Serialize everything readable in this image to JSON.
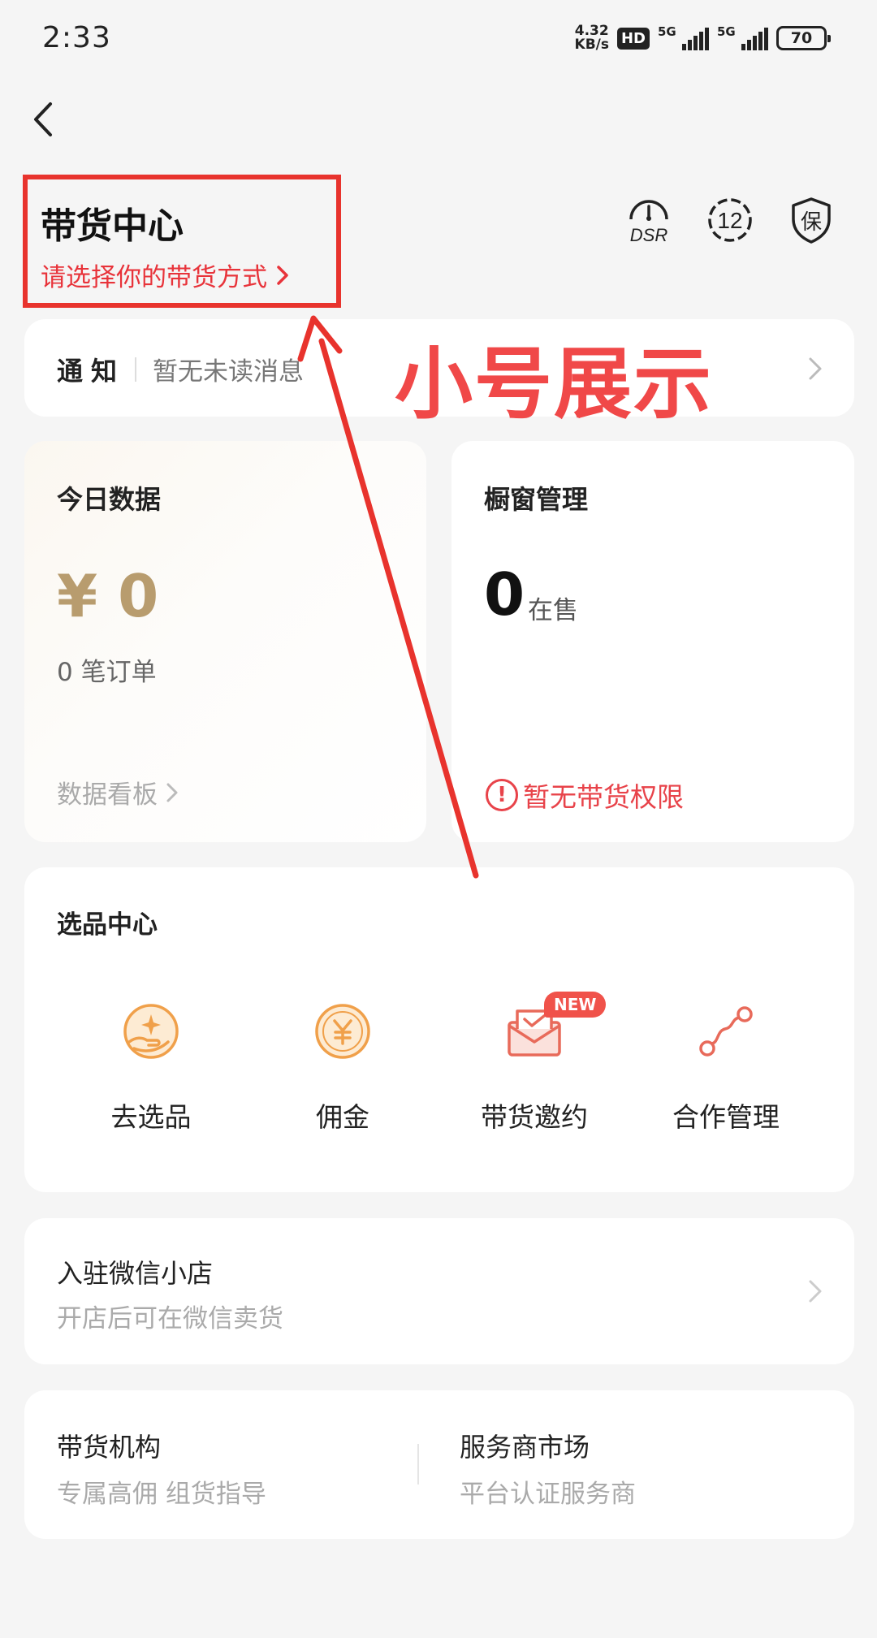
{
  "status_bar": {
    "time": "2:33",
    "net_speed_value": "4.32",
    "net_speed_unit": "KB/s",
    "hd_label": "HD",
    "sim1_tag": "5G",
    "sim2_tag": "5G",
    "battery": "70"
  },
  "header": {
    "title": "带货中心",
    "subtitle": "请选择你的带货方式",
    "icons": [
      "dsr-gauge-icon",
      "badge-12-icon",
      "shield-bao-icon"
    ],
    "dsr_label": "DSR",
    "twelve_label": "12",
    "bao_label": "保"
  },
  "notice": {
    "label": "通知",
    "text": "暂无未读消息"
  },
  "today_data": {
    "title": "今日数据",
    "amount": "¥ 0",
    "orders": "0 笔订单",
    "link": "数据看板"
  },
  "window_manage": {
    "title": "橱窗管理",
    "count": "0",
    "count_unit": "在售",
    "alert_icon": "!",
    "alert": "暂无带货权限"
  },
  "select_center": {
    "title": "选品中心",
    "items": [
      {
        "label": "去选品",
        "icon": "hand-sparkle-icon"
      },
      {
        "label": "佣金",
        "icon": "yuan-coin-icon"
      },
      {
        "label": "带货邀约",
        "icon": "envelope-check-icon",
        "badge": "NEW"
      },
      {
        "label": "合作管理",
        "icon": "link-nodes-icon"
      }
    ]
  },
  "wechat_shop": {
    "title": "入驻微信小店",
    "subtitle": "开店后可在微信卖货"
  },
  "bottom": {
    "agency_title": "带货机构",
    "agency_sub": "专属高佣 组货指导",
    "market_title": "服务商市场",
    "market_sub": "平台认证服务商"
  },
  "annotation": {
    "text": "小号展示"
  },
  "colors": {
    "accent_red": "#e8333a",
    "gold": "#b89c6e",
    "icon_orange": "#f0a04a",
    "icon_red": "#e86a5a",
    "background": "#f5f5f5"
  }
}
